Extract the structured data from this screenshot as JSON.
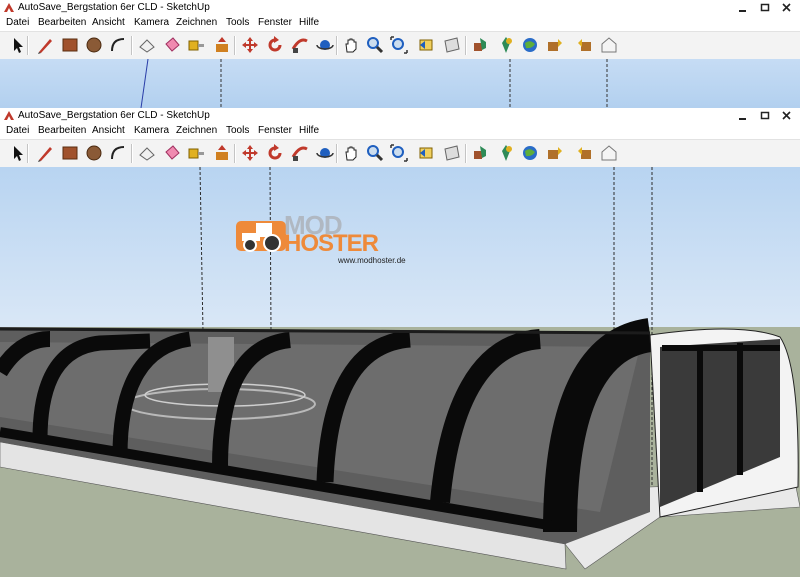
{
  "windows": [
    {
      "title": "AutoSave_Bergstation 6er CLD - SketchUp",
      "menu": [
        "Datei",
        "Bearbeiten",
        "Ansicht",
        "Kamera",
        "Zeichnen",
        "Tools",
        "Fenster",
        "Hilfe"
      ]
    },
    {
      "title": "AutoSave_Bergstation 6er CLD - SketchUp",
      "menu": [
        "Datei",
        "Bearbeiten",
        "Ansicht",
        "Kamera",
        "Zeichnen",
        "Tools",
        "Fenster",
        "Hilfe"
      ]
    }
  ],
  "toolbar_icons": [
    "select-icon",
    "pencil-icon",
    "rectangle-icon",
    "circle-icon",
    "arc-icon",
    "eraser-icon",
    "paint-bucket-icon",
    "tape-measure-icon",
    "push-pull-icon",
    "move-icon",
    "rotate-icon",
    "follow-me-icon",
    "orbit-icon",
    "pan-icon",
    "zoom-icon",
    "zoom-extents-icon",
    "previous-view-icon",
    "section-icon",
    "components-icon",
    "add-location-icon",
    "google-earth-icon",
    "get-models-icon",
    "share-model-icon",
    "warehouse-icon"
  ],
  "watermark": {
    "line1": "MOD",
    "line2": "HOSTER",
    "url": "www.modhoster.de"
  },
  "colors": {
    "sky_top": "#bcd6f2",
    "ground": "#a9b29c",
    "logo_orange": "#ee8a3a",
    "logo_gray": "#b0b8c2"
  }
}
